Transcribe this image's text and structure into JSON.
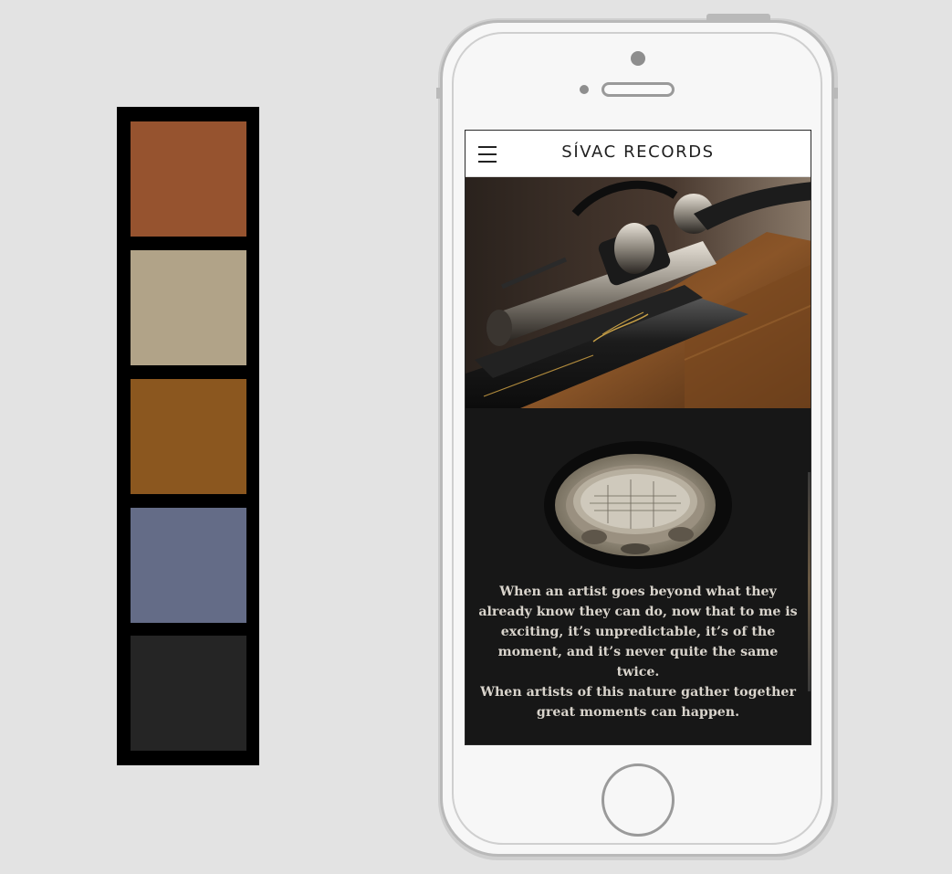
{
  "palette": {
    "swatches": [
      {
        "name": "rust",
        "color": "#96532f"
      },
      {
        "name": "sand",
        "color": "#b1a388"
      },
      {
        "name": "bronze",
        "color": "#8b571f"
      },
      {
        "name": "slate-blue",
        "color": "#646c87"
      },
      {
        "name": "charcoal",
        "color": "#252525"
      }
    ]
  },
  "app": {
    "title": "SÍVAC RECORDS",
    "menu_icon": "hamburger-menu-icon"
  },
  "content": {
    "quote_1": "When an artist goes beyond what they already know they can do, now that to me is exciting, it’s unpredictable, it’s of the moment, and it’s never quite the same twice.",
    "quote_2": "When artists of this nature gather together great moments can happen."
  },
  "colors": {
    "background": "#e3e3e3",
    "screen_dark": "#171717",
    "quote_text": "#d9d4cc"
  }
}
